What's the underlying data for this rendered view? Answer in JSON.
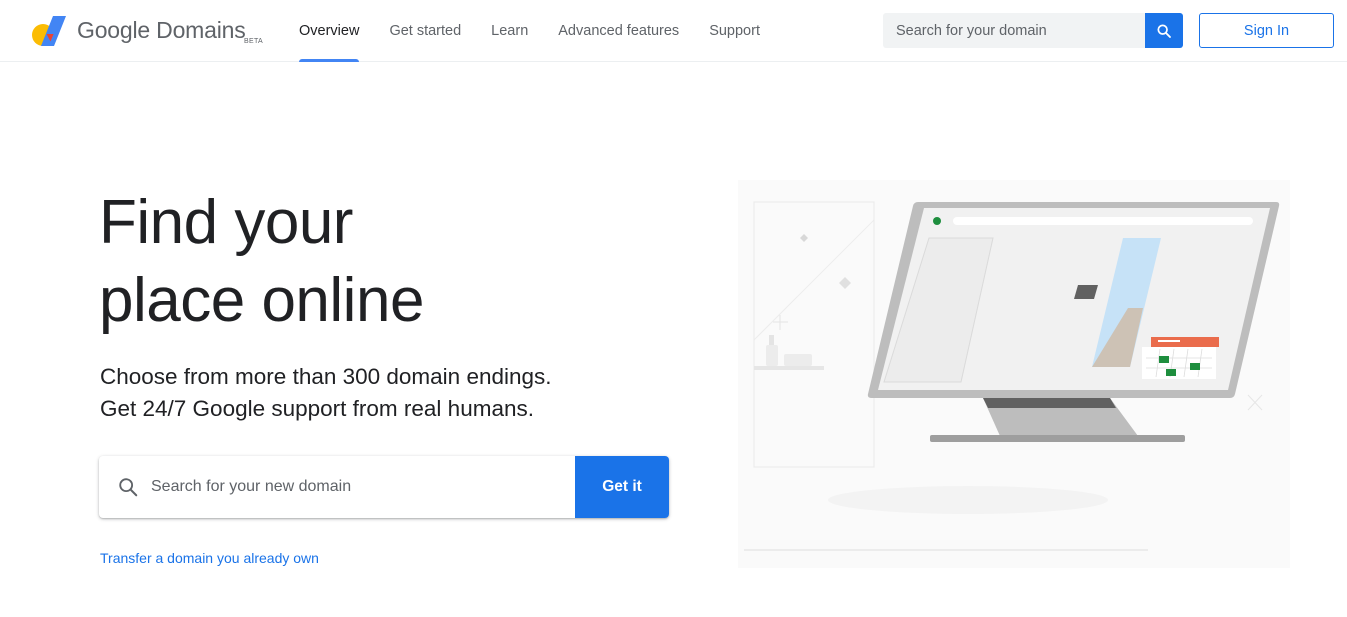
{
  "header": {
    "brand": "Google Domains",
    "beta": "BETA",
    "nav": [
      {
        "label": "Overview",
        "active": true
      },
      {
        "label": "Get started",
        "active": false
      },
      {
        "label": "Learn",
        "active": false
      },
      {
        "label": "Advanced features",
        "active": false
      },
      {
        "label": "Support",
        "active": false
      }
    ],
    "search_placeholder": "Search for your domain",
    "signin_label": "Sign In"
  },
  "hero": {
    "title_line1": "Find your",
    "title_line2": "place online",
    "subtitle_line1": "Choose from more than 300 domain endings.",
    "subtitle_line2": "Get 24/7 Google support from real humans.",
    "search_placeholder": "Search for your new domain",
    "cta_label": "Get it",
    "transfer_link": "Transfer a domain you already own"
  },
  "icons": {
    "logo": "google-domains-logo-icon",
    "search": "search-icon",
    "illustration": "monitor-illustration"
  },
  "colors": {
    "accent": "#1a73e8",
    "tab_indicator": "#4285f4",
    "text": "#202124",
    "muted": "#5f6368"
  }
}
